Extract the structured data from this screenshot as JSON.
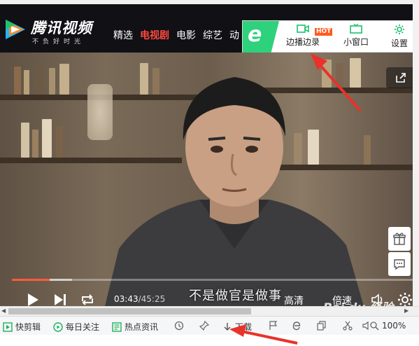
{
  "header": {
    "logo_title": "腾讯视频",
    "logo_slogan": "不负好时光",
    "nav": [
      "精选",
      "电视剧",
      "电影",
      "综艺",
      "动"
    ]
  },
  "extension": {
    "items": [
      {
        "label": "边播边录",
        "icon": "record-icon"
      },
      {
        "label": "小窗口",
        "icon": "tv-icon"
      },
      {
        "label": "设置",
        "icon": "gear-icon"
      }
    ],
    "hot_badge": "HOT"
  },
  "player": {
    "subtitle": "不是做官是做事",
    "time_current": "03:43",
    "time_total": "/45:25",
    "quality_label": "高清",
    "speed_label": "倍速",
    "progress": 0.094,
    "buffered": 0.15
  },
  "statusbar": {
    "items": [
      {
        "label": "快剪辑",
        "icon": "clip-icon"
      },
      {
        "label": "每日关注",
        "icon": "play-circle-icon"
      },
      {
        "label": "热点资讯",
        "icon": "news-icon"
      },
      {
        "label": "下载",
        "icon": "download-icon"
      }
    ],
    "zoom": "100%"
  },
  "watermark": "Bai du 经验",
  "colors": {
    "accent_red": "#ff4a3d",
    "ext_green": "#2ed17c",
    "progress_orange": "#ff5c38"
  }
}
